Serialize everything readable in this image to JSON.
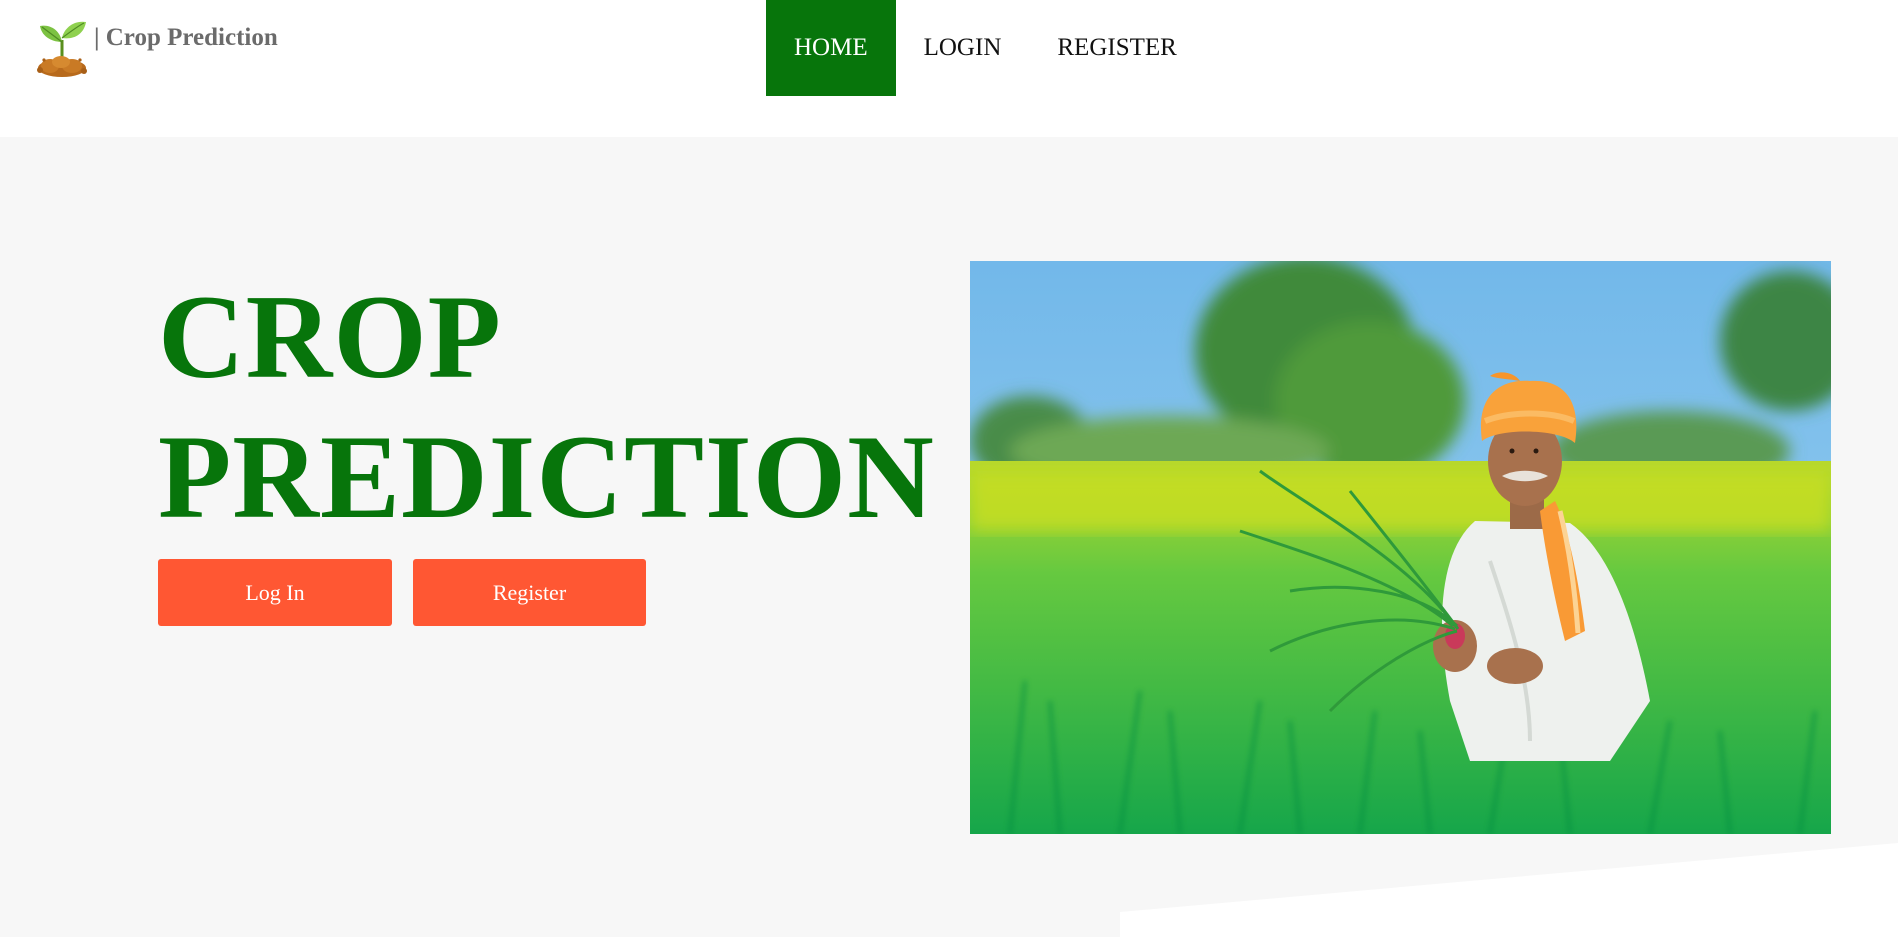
{
  "brand": {
    "name": "| Crop Prediction",
    "logo_icon": "sprout-in-soil-icon"
  },
  "nav": {
    "items": [
      {
        "label": "HOME",
        "active": true
      },
      {
        "label": "LOGIN",
        "active": false
      },
      {
        "label": "REGISTER",
        "active": false
      }
    ]
  },
  "hero": {
    "title_line1": "CROP",
    "title_line2": "PREDICTION",
    "login_label": "Log In",
    "register_label": "Register",
    "image_subject": "farmer-in-green-field-photo"
  },
  "colors": {
    "brand_green": "#07750b",
    "button_orange": "#ff5733",
    "hero_background": "#f7f7f7",
    "brand_text_gray": "#6b6b6b"
  }
}
